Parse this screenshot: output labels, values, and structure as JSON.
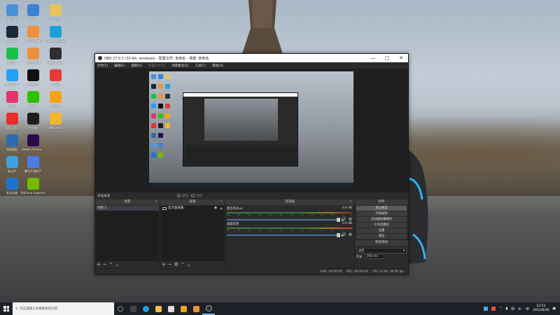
{
  "desktop": {
    "icons": [
      {
        "label": "此电脑",
        "icon": "computer-icon",
        "color": "#4a90d9"
      },
      {
        "label": "网络",
        "icon": "network-icon",
        "color": "#3c82d6"
      },
      {
        "label": "回收站",
        "icon": "recycle-bin-icon",
        "color": "#e8c35a"
      },
      {
        "label": "Steam",
        "icon": "steam-icon",
        "color": "#1b2838"
      },
      {
        "label": "飞行工具箱",
        "icon": "toolbox-icon",
        "color": "#f0903c"
      },
      {
        "label": "Microsoft Edge",
        "icon": "edge-icon",
        "color": "#1fa0d8"
      },
      {
        "label": "爱奇艺",
        "icon": "iqiyi-icon",
        "color": "#19c14b"
      },
      {
        "label": "飞行工具箱",
        "icon": "toolbox-icon",
        "color": "#f0903c"
      },
      {
        "label": "OBS Studio",
        "icon": "obs-icon",
        "color": "#302e31"
      },
      {
        "label": "腾讯视频",
        "icon": "tencent-video-icon",
        "color": "#21a0f6"
      },
      {
        "label": "腾讯QQ",
        "icon": "qq-icon",
        "color": "#111111"
      },
      {
        "label": "飞行棋",
        "icon": "chess-icon",
        "color": "#e43a3a"
      },
      {
        "label": "优酷",
        "icon": "youku-icon",
        "color": "#e1366a"
      },
      {
        "label": "微信",
        "icon": "wechat-icon",
        "color": "#2dc100"
      },
      {
        "label": "u号租",
        "icon": "uhaozu-icon",
        "color": "#f5a21a"
      },
      {
        "label": "网易云音乐",
        "icon": "netease-music-icon",
        "color": "#e72d2c"
      },
      {
        "label": "快剪辑",
        "icon": "quick-edit-icon",
        "color": "#1e1e1e"
      },
      {
        "label": "WeGame",
        "icon": "wegame-icon",
        "color": "#f1b72e"
      },
      {
        "label": "控制面板",
        "icon": "control-panel-icon",
        "color": "#2b6cb0"
      },
      {
        "label": "Adobe Premie...",
        "icon": "premiere-icon",
        "color": "#2a0a4a"
      },
      {
        "label": "",
        "icon": "blank-icon",
        "color": "transparent"
      },
      {
        "label": "驱动中",
        "icon": "driver-icon",
        "color": "#3fa0e0"
      },
      {
        "label": "腾讯手游助手",
        "icon": "game-assistant-icon",
        "color": "#4c7be8"
      },
      {
        "label": "",
        "icon": "blank-icon",
        "color": "transparent"
      },
      {
        "label": "驱动总裁",
        "icon": "driver-master-icon",
        "color": "#1b75d0"
      },
      {
        "label": "GeForce Experience",
        "icon": "geforce-icon",
        "color": "#76b900"
      }
    ]
  },
  "obs": {
    "title": "OBS 27.0.1 (32-bit, windows) - 配置文件: 未命名 - 场景: 未命名",
    "menu": [
      "文件(F)",
      "编辑(E)",
      "视图(V)",
      "配置文件(P)",
      "场景集合(S)",
      "工具(T)",
      "帮助(H)"
    ],
    "no_source": "未选择源",
    "props_btn": "属性",
    "filters_btn": "滤镜",
    "docks": {
      "scenes": {
        "title": "场景",
        "items": [
          "场景 2"
        ]
      },
      "sources": {
        "title": "来源",
        "items": [
          "显示器采集"
        ]
      },
      "mixer": {
        "title": "混音器",
        "channels": [
          {
            "name": "麦克风/Aux",
            "db": "0.0 dB"
          },
          {
            "name": "桌面音频",
            "db": "0.0 dB"
          }
        ],
        "ticks": [
          "-60",
          "-55",
          "-50",
          "-45",
          "-40",
          "-35",
          "-30",
          "-25",
          "-20",
          "-15",
          "-10",
          "-5",
          "0"
        ]
      },
      "controls": {
        "title": "控件",
        "buttons": [
          "停止推流",
          "开始录制",
          "启动虚拟摄像机",
          "工作室模式",
          "设置",
          "退出"
        ]
      },
      "transitions": {
        "title": "转场特效",
        "selected": "淡出",
        "duration_label": "时长",
        "duration": "300 ms"
      }
    },
    "status": {
      "live": "LIVE: 00:00:00",
      "rec": "REC: 00:00:00",
      "cpu": "CPU: 0.3%, 60.00 fps"
    }
  },
  "taskbar": {
    "search_placeholder": "在这里输入你要搜索的内容",
    "time": "12:53",
    "date": "2021/8/28"
  }
}
